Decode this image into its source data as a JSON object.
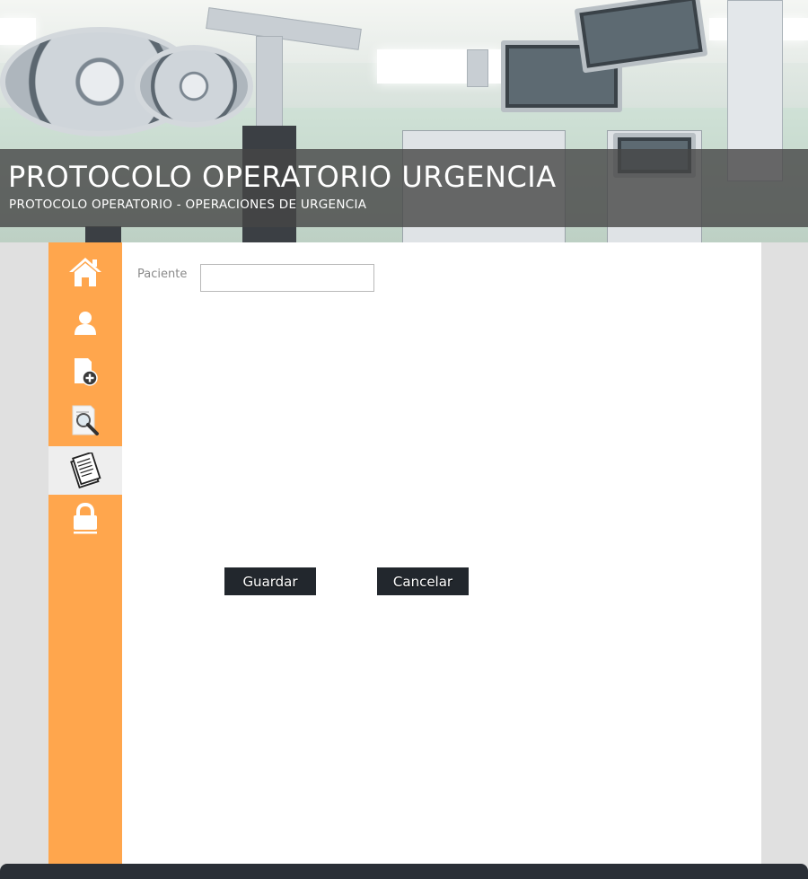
{
  "header": {
    "title": "PROTOCOLO OPERATORIO URGENCIA",
    "subtitle": "PROTOCOLO OPERATORIO - OPERACIONES DE URGENCIA"
  },
  "sidebar": {
    "accent_color": "#ffa64d",
    "active_background": "#eeeeee",
    "items": [
      {
        "icon": "home-icon",
        "active": false
      },
      {
        "icon": "user-icon",
        "active": false
      },
      {
        "icon": "new-document-icon",
        "active": false
      },
      {
        "icon": "search-document-icon",
        "active": false
      },
      {
        "icon": "notebook-icon",
        "active": true
      },
      {
        "icon": "lock-icon",
        "active": false
      }
    ]
  },
  "form": {
    "patient_label": "Paciente",
    "patient_value": "",
    "save_label": "Guardar",
    "cancel_label": "Cancelar"
  },
  "colors": {
    "button_bg": "#22272d",
    "page_bg": "#e0e0e0",
    "footer_bg": "#2a2f36"
  }
}
